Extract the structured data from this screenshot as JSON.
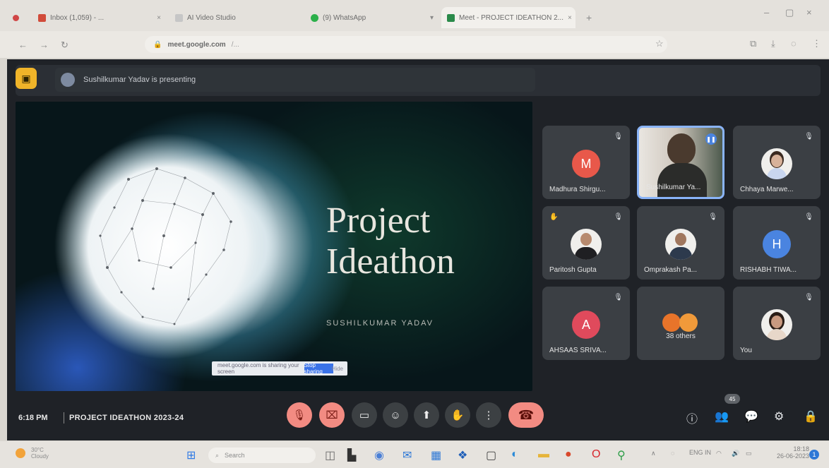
{
  "browser": {
    "tabs": [
      {
        "label": "Inbox (1,059) - ...",
        "icon_color": "#d14b3a"
      },
      {
        "label": "AI Video Studio",
        "icon_color": "#c6c6c6"
      },
      {
        "label": "(9) WhatsApp",
        "icon_color": "#2bb04a"
      },
      {
        "label": "Meet - PROJECT IDEATHON 2...",
        "icon_color": "#2a8a4a"
      }
    ],
    "url_host": "meet.google.com",
    "url_rest": "/..."
  },
  "meet": {
    "presenting_label": "Sushilkumar Yadav is presenting",
    "slide": {
      "title_line1": "Project",
      "title_line2": "Ideathon",
      "subtitle": "SUSHILKUMAR YADAV",
      "share_text": "meet.google.com is sharing your screen",
      "stop_label": "Stop sharing",
      "hide_label": "Hide"
    },
    "participants": [
      {
        "name": "Madhura Shirgu...",
        "initial": "M",
        "color": "#e8584a",
        "type": "initial"
      },
      {
        "name": "Sushilkumar Ya...",
        "type": "video"
      },
      {
        "name": "Chhaya Marwe...",
        "type": "photo"
      },
      {
        "name": "Paritosh Gupta",
        "type": "photo"
      },
      {
        "name": "Omprakash Pa...",
        "type": "photo"
      },
      {
        "name": "RISHABH TIWA...",
        "initial": "H",
        "color": "#4a84e0",
        "type": "initial"
      },
      {
        "name": "AHSAAS SRIVA...",
        "initial": "A",
        "color": "#e04a5c",
        "type": "initial"
      },
      {
        "name": "38 others",
        "type": "others"
      },
      {
        "name": "You",
        "type": "photo"
      }
    ],
    "bottom": {
      "time": "6:18 PM",
      "meeting_title": "PROJECT IDEATHON 2023-24",
      "people_count": "45"
    }
  },
  "taskbar": {
    "weather_temp": "30°C",
    "weather_desc": "Cloudy",
    "search_placeholder": "Search",
    "lang": "ENG IN",
    "time": "18:18",
    "date": "26-06-2023"
  }
}
